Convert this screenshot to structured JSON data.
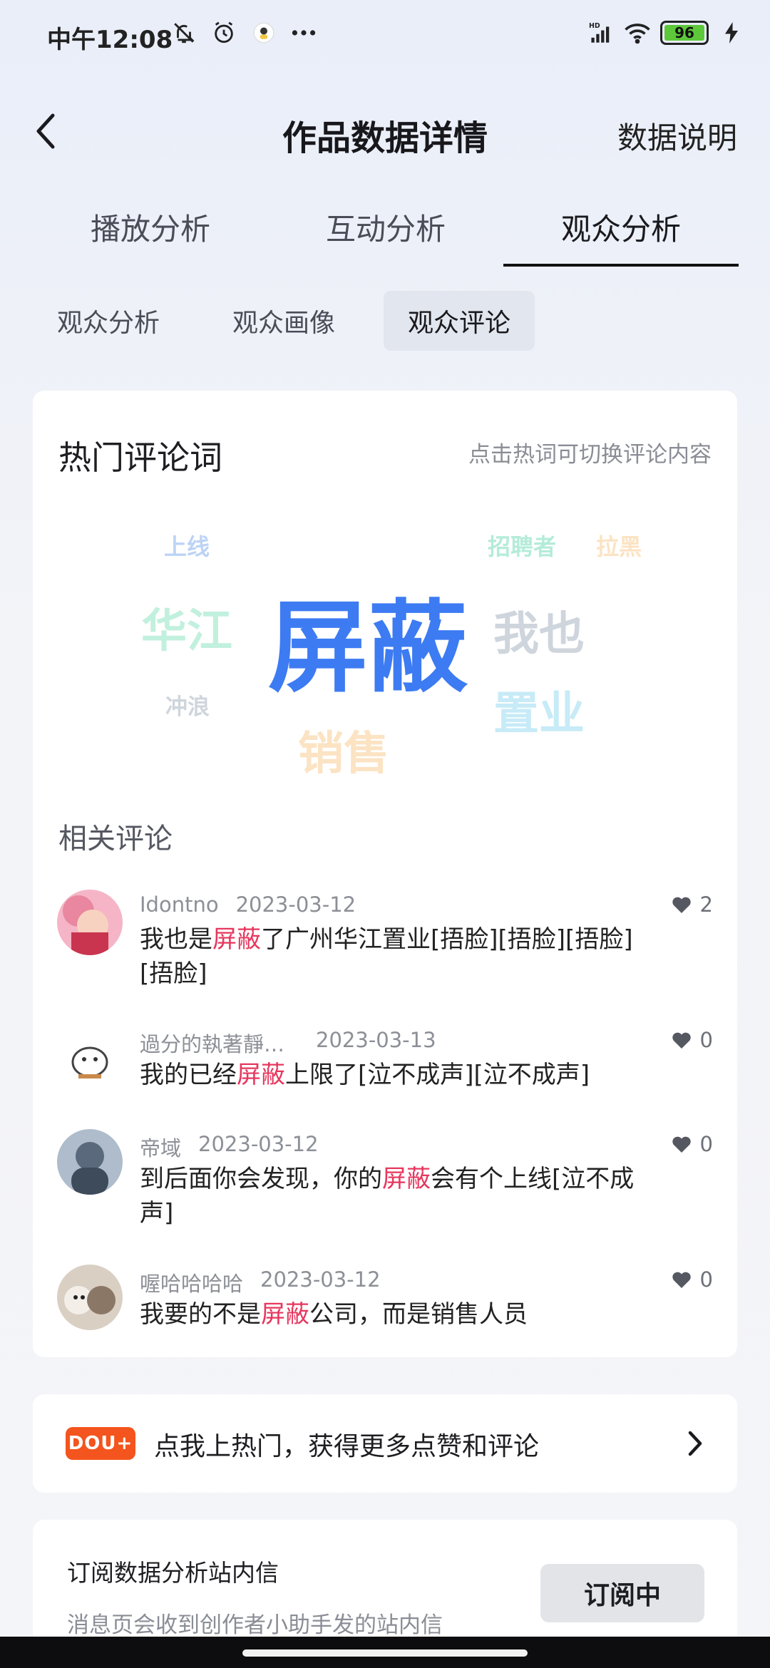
{
  "status_bar": {
    "time": "中午12:08",
    "battery": "96",
    "network": "HD"
  },
  "header": {
    "title": "作品数据详情",
    "right_link": "数据说明"
  },
  "main_tabs": [
    {
      "label": "播放分析"
    },
    {
      "label": "互动分析"
    },
    {
      "label": "观众分析"
    }
  ],
  "main_tab_active": "观众分析",
  "sub_tabs": [
    {
      "label": "观众分析"
    },
    {
      "label": "观众画像"
    },
    {
      "label": "观众评论"
    }
  ],
  "sub_tab_active": "观众评论",
  "hot_words": {
    "title": "热门评论词",
    "hint": "点击热词可切换评论内容",
    "words": [
      {
        "text": "上线",
        "color": "#bcd3f5"
      },
      {
        "text": "招聘者",
        "color": "#b4ecd9"
      },
      {
        "text": "拉黑",
        "color": "#fbe3c3"
      },
      {
        "text": "华江",
        "color": "#c2f0de"
      },
      {
        "text": "屏蔽",
        "color": "#3d7bf2"
      },
      {
        "text": "我也",
        "color": "#cfd5dc"
      },
      {
        "text": "冲浪",
        "color": "#cfd5dc"
      },
      {
        "text": "置业",
        "color": "#c7ebf7"
      },
      {
        "text": "销售",
        "color": "#fbe3c3"
      }
    ]
  },
  "related": {
    "title": "相关评论",
    "comments": [
      {
        "user": "Idontno",
        "date": "2023-03-12",
        "pre": "我也是",
        "hl": "屏蔽",
        "post": "了广州华江置业[捂脸][捂脸][捂脸][捂脸]",
        "likes": "2"
      },
      {
        "user": "過分的執著靜…",
        "date": "2023-03-13",
        "pre": "我的已经",
        "hl": "屏蔽",
        "post": "上限了[泣不成声][泣不成声]",
        "likes": "0"
      },
      {
        "user": "帝域",
        "date": "2023-03-12",
        "pre": "到后面你会发现，你的",
        "hl": "屏蔽",
        "post": "会有个上线[泣不成声]",
        "likes": "0"
      },
      {
        "user": "喔哈哈哈哈",
        "date": "2023-03-12",
        "pre": "我要的不是",
        "hl": "屏蔽",
        "post": "公司，而是销售人员",
        "likes": "0"
      }
    ]
  },
  "promo": {
    "badge": "DOU+",
    "text": "点我上热门，获得更多点赞和评论"
  },
  "subscribe": {
    "title": "订阅数据分析站内信",
    "desc": "消息页会收到创作者小助手发的站内信",
    "button": "订阅中"
  },
  "colors": {
    "accent": "#3d7bf2",
    "highlight": "#e6375e",
    "dou": "#f4541d"
  }
}
